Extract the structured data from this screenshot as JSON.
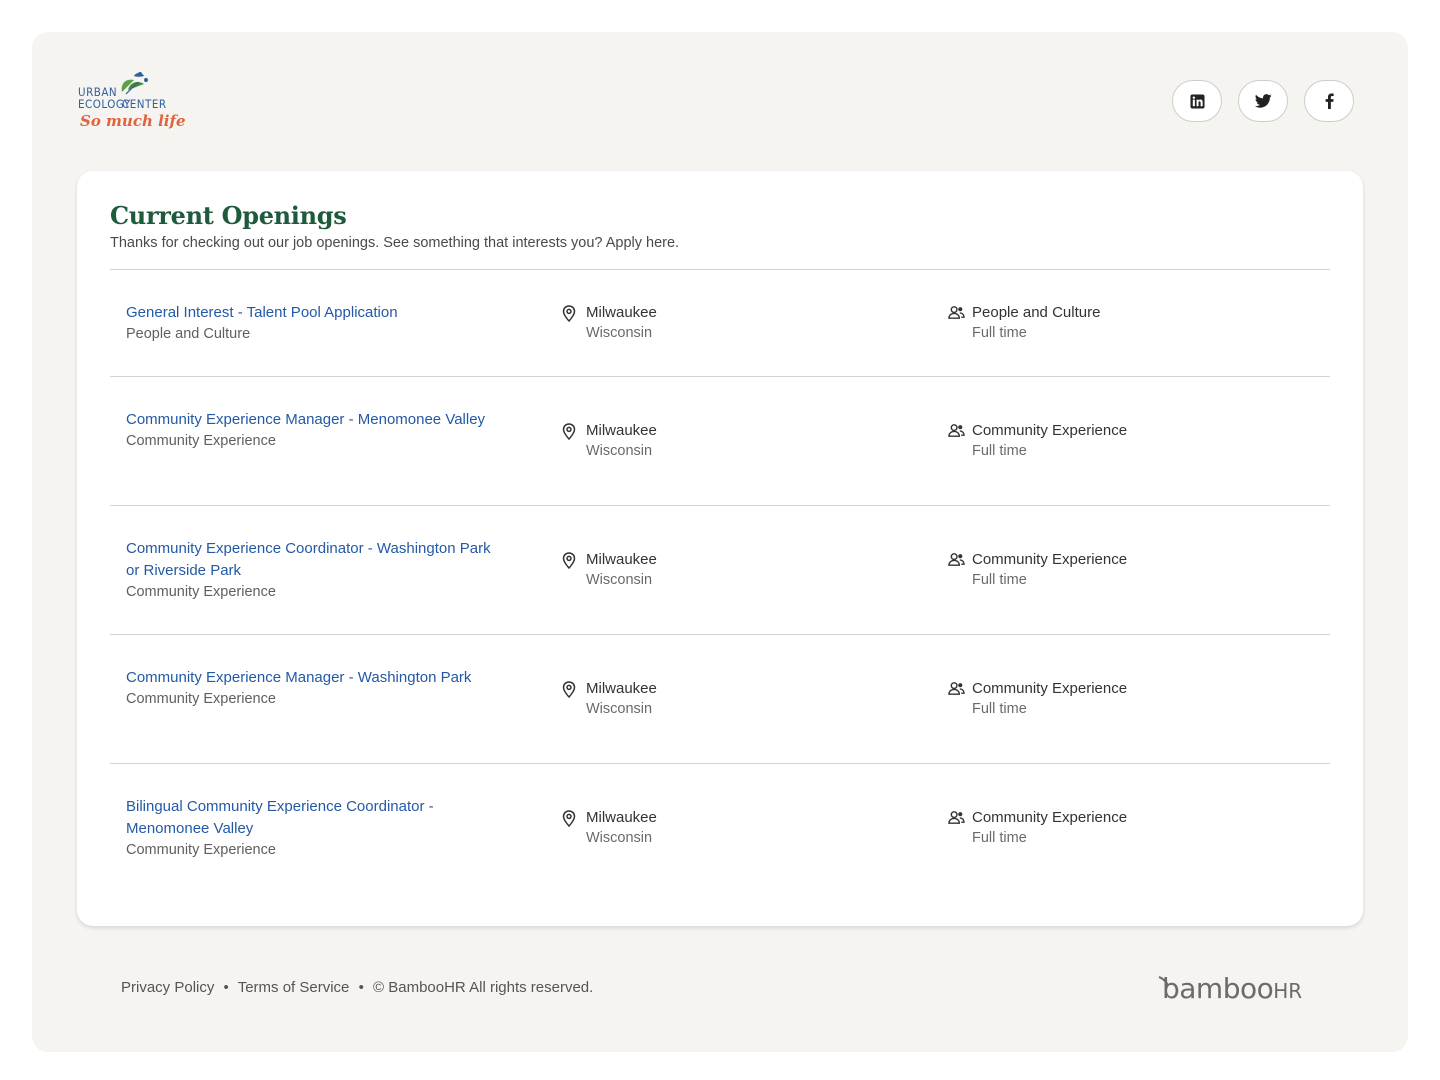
{
  "brand": {
    "logo_line1": "URBAN",
    "logo_line2a": "ECOLOGY",
    "logo_line2b": "CENTER",
    "logo_tagline": "So much life"
  },
  "social": [
    {
      "name": "LinkedIn",
      "icon": "linkedin-icon"
    },
    {
      "name": "Twitter",
      "icon": "twitter-icon"
    },
    {
      "name": "Facebook",
      "icon": "facebook-icon"
    }
  ],
  "openings": {
    "title": "Current Openings",
    "subtitle": "Thanks for checking out our job openings. See something that interests you? Apply here.",
    "jobs": [
      {
        "title": "General Interest - Talent Pool Application",
        "department": "People and Culture",
        "city": "Milwaukee",
        "state": "Wisconsin",
        "team": "People and Culture",
        "type": "Full time"
      },
      {
        "title": "Community Experience Manager - Menomonee Valley",
        "department": "Community Experience",
        "city": "Milwaukee",
        "state": "Wisconsin",
        "team": "Community Experience",
        "type": "Full time"
      },
      {
        "title": "Community Experience Coordinator - Washington Park or Riverside Park",
        "department": "Community Experience",
        "city": "Milwaukee",
        "state": "Wisconsin",
        "team": "Community Experience",
        "type": "Full time"
      },
      {
        "title": "Community Experience Manager - Washington Park",
        "department": "Community Experience",
        "city": "Milwaukee",
        "state": "Wisconsin",
        "team": "Community Experience",
        "type": "Full time"
      },
      {
        "title": "Bilingual Community Experience Coordinator - Menomonee Valley",
        "department": "Community Experience",
        "city": "Milwaukee",
        "state": "Wisconsin",
        "team": "Community Experience",
        "type": "Full time"
      }
    ]
  },
  "footer": {
    "privacy": "Privacy Policy",
    "bullet": "•",
    "terms": "Terms of Service",
    "copyright": "© BambooHR All rights reserved.",
    "powered_by_main": "bamboo",
    "powered_by_suffix": "HR"
  },
  "colors": {
    "page_bg": "#f5f4f1",
    "card_bg": "#ffffff",
    "heading_green": "#1e5a3c",
    "link_blue": "#2359a6",
    "logo_blue": "#2f5f9e",
    "logo_orange": "#e2623c"
  }
}
